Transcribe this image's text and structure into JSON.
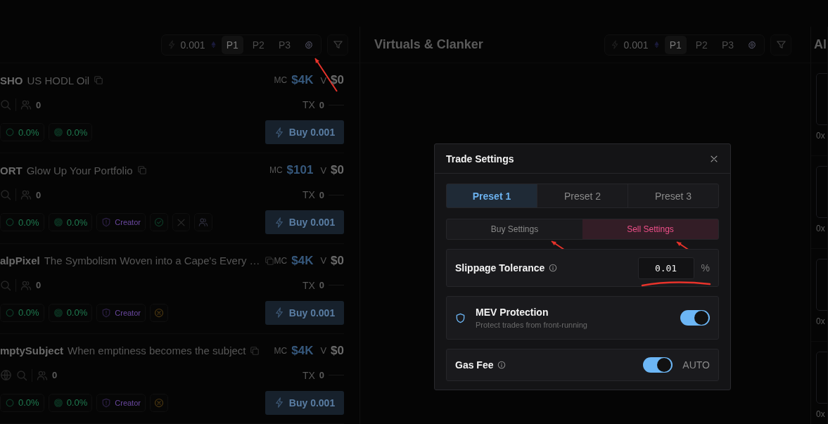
{
  "left_panel": {
    "toolbar": {
      "amount": "0.001",
      "presets": [
        {
          "label": "P1",
          "selected": true
        },
        {
          "label": "P2",
          "selected": false
        },
        {
          "label": "P3",
          "selected": false
        }
      ],
      "settings_annotated": true
    },
    "tokens": [
      {
        "ticker": "SHO",
        "name": "US HODL Oil",
        "mc_label": "MC",
        "mc": "$4K",
        "v_label": "V",
        "volume": "$0",
        "website": false,
        "holders": "0",
        "tx_label": "TX",
        "tx": "0",
        "stats": [
          {
            "kind": "circle",
            "value": "0.0%"
          },
          {
            "kind": "target",
            "value": "0.0%"
          }
        ],
        "buy": "Buy 0.001"
      },
      {
        "ticker": "ORT",
        "name": "Glow Up Your Portfolio",
        "mc_label": "MC",
        "mc": "$101",
        "v_label": "V",
        "volume": "$0",
        "website": false,
        "holders": "0",
        "tx_label": "TX",
        "tx": "0",
        "stats": [
          {
            "kind": "circle",
            "value": "0.0%"
          },
          {
            "kind": "target",
            "value": "0.0%"
          }
        ],
        "tags": [
          {
            "kind": "creator",
            "label": "Creator"
          },
          {
            "kind": "check"
          },
          {
            "kind": "x"
          },
          {
            "kind": "people"
          }
        ],
        "buy": "Buy 0.001"
      },
      {
        "ticker": "alpPixel",
        "name": "The Symbolism Woven into a Cape's Every …",
        "mc_label": "MC",
        "mc": "$4K",
        "v_label": "V",
        "volume": "$0",
        "website": false,
        "holders": "0",
        "tx_label": "TX",
        "tx": "0",
        "stats": [
          {
            "kind": "circle",
            "value": "0.0%"
          },
          {
            "kind": "target",
            "value": "0.0%"
          }
        ],
        "tags": [
          {
            "kind": "creator",
            "label": "Creator"
          },
          {
            "kind": "cross"
          }
        ],
        "buy": "Buy 0.001"
      },
      {
        "ticker": "mptySubject",
        "name": "When emptiness becomes the subject",
        "mc_label": "MC",
        "mc": "$4K",
        "v_label": "V",
        "volume": "$0",
        "website": true,
        "holders": "0",
        "tx_label": "TX",
        "tx": "0",
        "stats": [
          {
            "kind": "circle",
            "value": "0.0%"
          },
          {
            "kind": "target",
            "value": "0.0%"
          }
        ],
        "tags": [
          {
            "kind": "creator",
            "label": "Creator"
          },
          {
            "kind": "cross"
          }
        ],
        "buy": "Buy 0.001"
      }
    ]
  },
  "middle_panel": {
    "title": "Virtuals & Clanker",
    "toolbar": {
      "amount": "0.001",
      "presets": [
        {
          "label": "P1",
          "selected": true
        },
        {
          "label": "P2",
          "selected": false
        },
        {
          "label": "P3",
          "selected": false
        }
      ]
    }
  },
  "right_panel": {
    "title": "Al",
    "cards": [
      {
        "address": "0x"
      },
      {
        "address": "0x"
      },
      {
        "address": "0x"
      },
      {
        "address": "0x"
      }
    ]
  },
  "modal": {
    "title": "Trade Settings",
    "presets": [
      {
        "label": "Preset 1",
        "selected": true
      },
      {
        "label": "Preset 2",
        "selected": false
      },
      {
        "label": "Preset 3",
        "selected": false
      }
    ],
    "sides": [
      {
        "label": "Buy Settings",
        "kind": "buy",
        "selected": false,
        "annotated": true
      },
      {
        "label": "Sell Settings",
        "kind": "sell",
        "selected": true,
        "annotated": true
      }
    ],
    "slippage": {
      "label": "Slippage Tolerance",
      "value": "0.01",
      "unit": "%",
      "annotated": true
    },
    "mev": {
      "title": "MEV Protection",
      "description": "Protect trades from front-running",
      "on": true
    },
    "gas": {
      "label": "Gas Fee",
      "on": true,
      "mode": "AUTO"
    }
  }
}
